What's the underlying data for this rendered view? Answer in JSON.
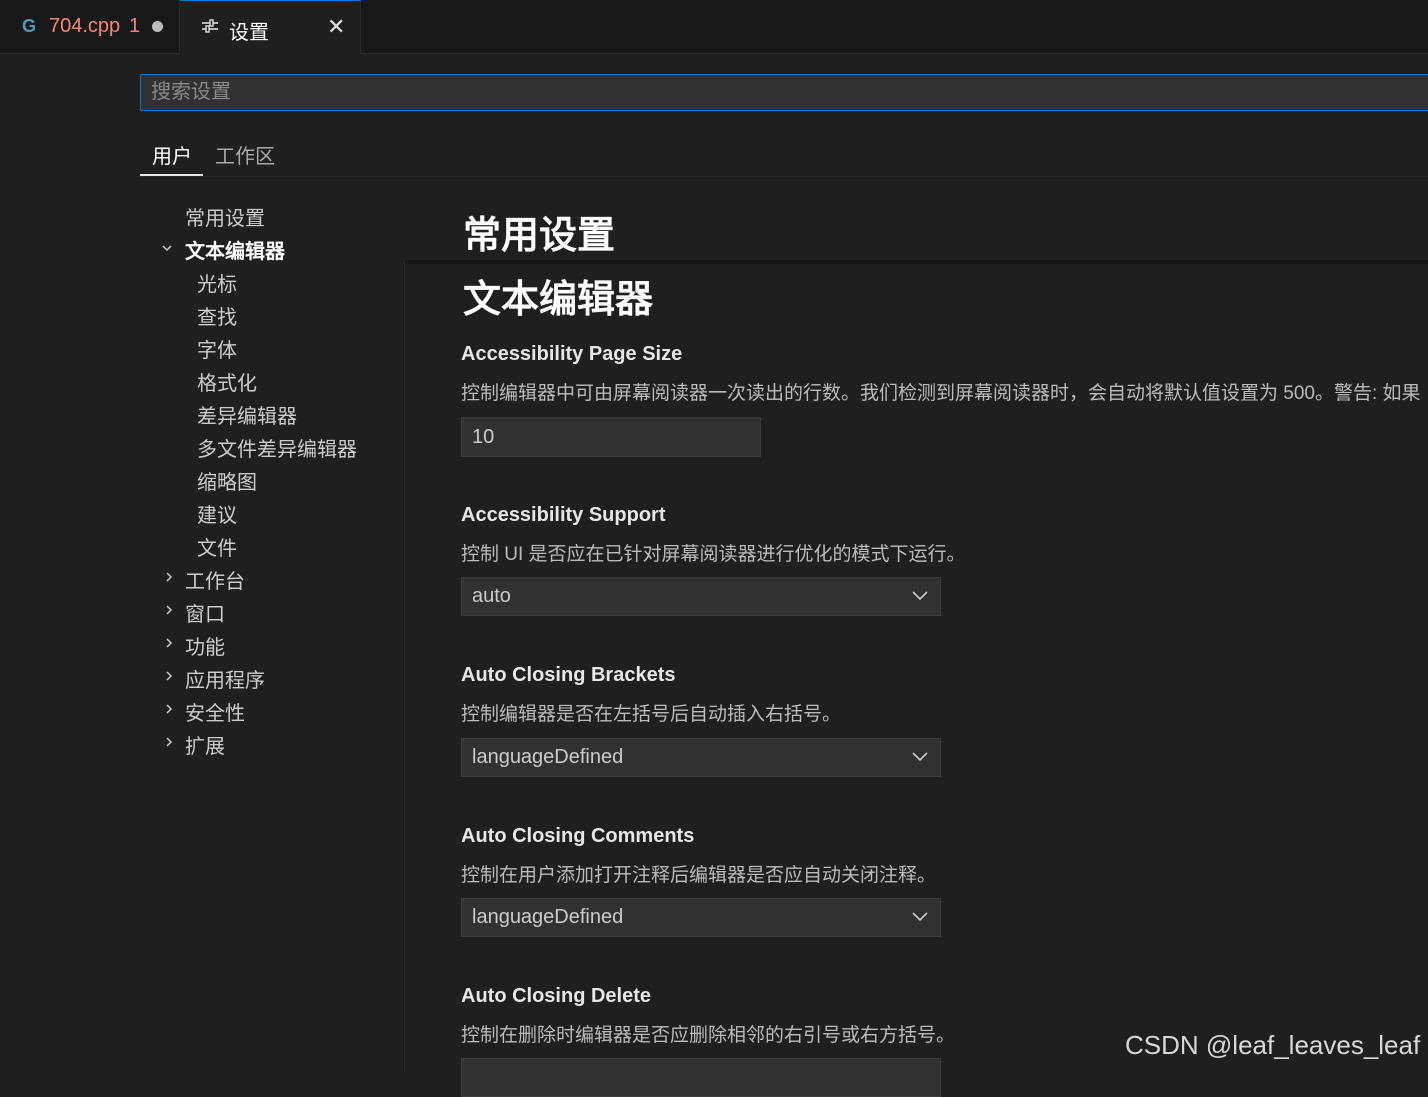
{
  "tabs": [
    {
      "icon": "cpp-file-icon",
      "icon_glyph": "G",
      "label": "704.cpp",
      "badge": "1",
      "modified": true
    },
    {
      "icon": "settings-sliders-icon",
      "label": "设置",
      "close_glyph": "✕"
    }
  ],
  "search": {
    "placeholder": "搜索设置",
    "value": ""
  },
  "scope_tabs": {
    "user": "用户",
    "workspace": "工作区"
  },
  "toc": {
    "items": [
      {
        "label": "常用设置"
      },
      {
        "label": "文本编辑器",
        "expanded": true,
        "active": true
      },
      {
        "label": "光标"
      },
      {
        "label": "查找"
      },
      {
        "label": "字体"
      },
      {
        "label": "格式化"
      },
      {
        "label": "差异编辑器"
      },
      {
        "label": "多文件差异编辑器"
      },
      {
        "label": "缩略图"
      },
      {
        "label": "建议"
      },
      {
        "label": "文件"
      },
      {
        "label": "工作台",
        "expanded": false
      },
      {
        "label": "窗口",
        "expanded": false
      },
      {
        "label": "功能",
        "expanded": false
      },
      {
        "label": "应用程序",
        "expanded": false
      },
      {
        "label": "安全性",
        "expanded": false
      },
      {
        "label": "扩展",
        "expanded": false
      }
    ]
  },
  "content": {
    "heading_common": "常用设置",
    "heading_text_editor": "文本编辑器",
    "settings": [
      {
        "title": "Accessibility Page Size",
        "description": "控制编辑器中可由屏幕阅读器一次读出的行数。我们检测到屏幕阅读器时，会自动将默认值设置为 500。警告: 如果",
        "control": "text",
        "value": "10"
      },
      {
        "title": "Accessibility Support",
        "description": "控制 UI 是否应在已针对屏幕阅读器进行优化的模式下运行。",
        "control": "select",
        "value": "auto"
      },
      {
        "title": "Auto Closing Brackets",
        "description": "控制编辑器是否在左括号后自动插入右括号。",
        "control": "select",
        "value": "languageDefined"
      },
      {
        "title": "Auto Closing Comments",
        "description": "控制在用户添加打开注释后编辑器是否应自动关闭注释。",
        "control": "select",
        "value": "languageDefined"
      },
      {
        "title": "Auto Closing Delete",
        "description": "控制在删除时编辑器是否应删除相邻的右引号或右方括号。",
        "control": "select",
        "value": ""
      }
    ]
  },
  "watermark": "CSDN @leaf_leaves_leaf",
  "colors": {
    "accent": "#0078d4",
    "background": "#1f1f1f",
    "error": "#f48771"
  }
}
